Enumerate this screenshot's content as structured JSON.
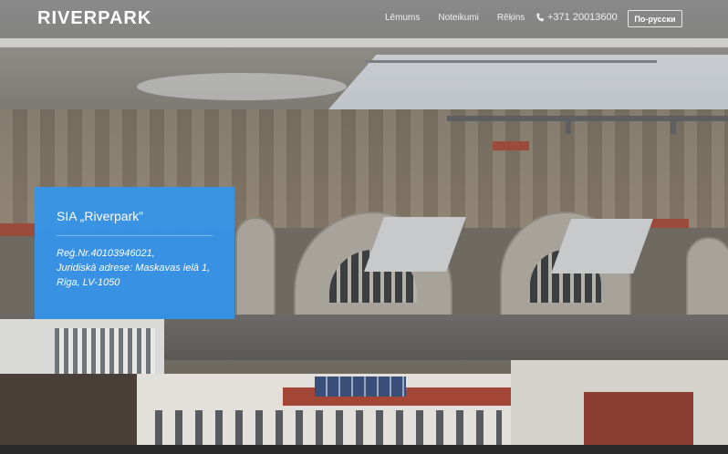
{
  "navbar": {
    "brand": "RIVERPARK",
    "links": [
      "Lēmums",
      "Noteikumi",
      "Rēķins"
    ],
    "phone": "+371 20013600",
    "language_button": "По-русски"
  },
  "info_card": {
    "title": "SIA „Riverpark”",
    "lines": [
      "Reģ.Nr.40103946021,",
      "Juridiskā adrese: Maskavas ielā 1,",
      "Rīga, LV-1050"
    ]
  },
  "colors": {
    "card_background": "#3494EC",
    "navbar_background": "rgba(70,70,70,0.55)"
  },
  "icons": {
    "phone": "phone-icon"
  }
}
